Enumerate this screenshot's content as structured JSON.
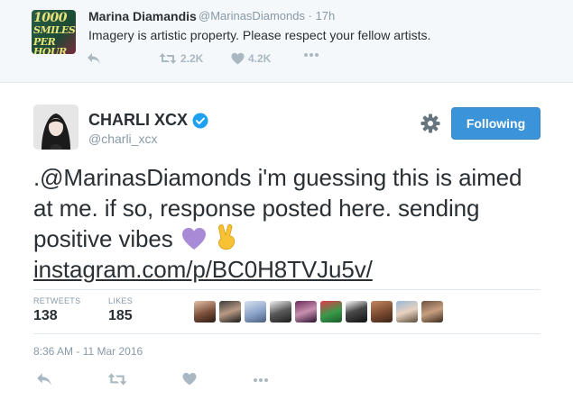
{
  "parent_tweet": {
    "avatar_text": [
      "1000",
      "SMILES",
      "PER HOUR"
    ],
    "name": "Marina Diamandis",
    "handle": "@MarinasDiamonds",
    "separator": "·",
    "time": "17h",
    "text": "Imagery is artistic property. Please respect your fellow artists.",
    "retweet_count": "2.2K",
    "like_count": "4.2K"
  },
  "tweet": {
    "name": "CHARLI XCX",
    "handle": "@charli_xcx",
    "follow_label": "Following",
    "text_line1": ".@MarinasDiamonds i'm guessing this is aimed",
    "text_line2": "at me. if so, response posted here. sending",
    "text_line3": "positive vibes",
    "link": "instagram.com/p/BC0H8TVJu5v/",
    "retweets_label": "RETWEETS",
    "retweets_count": "138",
    "likes_label": "LIKES",
    "likes_count": "185",
    "timestamp": "8:36 AM - 11 Mar 2016"
  },
  "colors": {
    "accent": "#3b94d9",
    "verified": "#1da1f2",
    "muted": "#8899a6",
    "icon": "#aab8c2"
  },
  "icons": {
    "verified": "verified-badge-icon",
    "settings": "gear-icon",
    "reply": "reply-icon",
    "retweet": "retweet-icon",
    "like": "heart-icon",
    "more": "more-icon"
  }
}
